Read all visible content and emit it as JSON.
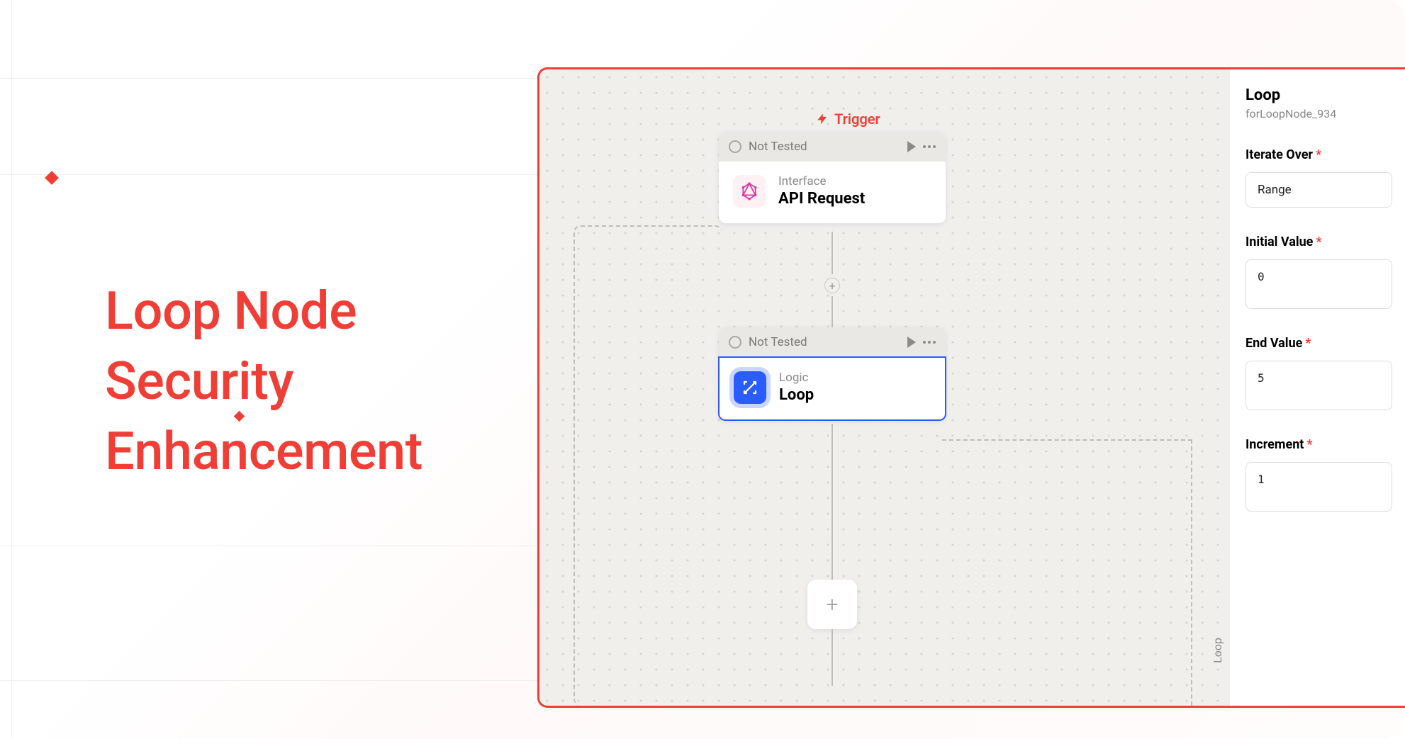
{
  "headline": "Loop Node\nSecurity\nEnhancement",
  "trigger_label": "Trigger",
  "node1": {
    "status": "Not Tested",
    "category": "Interface",
    "title": "API Request"
  },
  "node2": {
    "status": "Not Tested",
    "category": "Logic",
    "title": "Loop"
  },
  "loop_side_label": "Loop",
  "props": {
    "title": "Loop",
    "sub": "forLoopNode_934",
    "iterate_over": {
      "label": "Iterate Over",
      "value": "Range"
    },
    "initial_value": {
      "label": "Initial Value",
      "value": "0"
    },
    "end_value": {
      "label": "End Value",
      "value": "5"
    },
    "increment": {
      "label": "Increment",
      "value": "1"
    }
  }
}
